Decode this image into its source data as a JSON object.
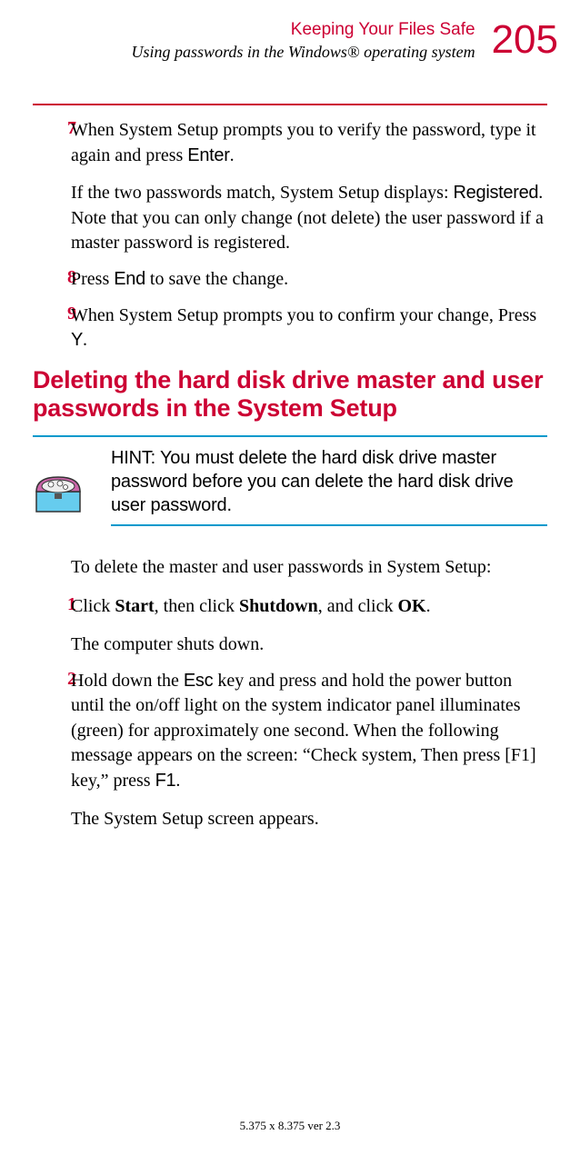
{
  "header": {
    "title": "Keeping Your Files Safe",
    "subtitle": "Using passwords in the Windows® operating system",
    "page_number": "205"
  },
  "steps_top": [
    {
      "num": "7",
      "p1_a": "When System Setup prompts you to verify the password, type it again and press ",
      "p1_k": "Enter",
      "p1_b": ".",
      "p2_a": "If the two passwords match, System Setup displays: ",
      "p2_k": "Registered",
      "p2_b": ". Note that you can only change (not delete) the user password if a master password is registered."
    },
    {
      "num": "8",
      "p1_a": "Press ",
      "p1_k": "End",
      "p1_b": " to save the change."
    },
    {
      "num": "9",
      "p1_a": "When System Setup prompts you to confirm your change, Press ",
      "p1_k": "Y",
      "p1_b": "."
    }
  ],
  "section_heading": "Deleting the hard disk drive master and user passwords in the System Setup",
  "hint": "HINT: You must delete the hard disk drive master password before you can delete the hard disk drive user password.",
  "intro": "To delete the master and user passwords in System Setup:",
  "steps_bottom": [
    {
      "num": "1",
      "p1_a": "Click ",
      "p1_s1": "Start",
      "p1_b": ", then click ",
      "p1_s2": "Shutdown",
      "p1_c": ", and click ",
      "p1_s3": "OK",
      "p1_d": ".",
      "p2": "The computer shuts down."
    },
    {
      "num": "2",
      "p1_a": "Hold down the ",
      "p1_k1": "Esc",
      "p1_b": " key and press and hold the power button until the on/off light on the system indicator panel illuminates (green) for approximately one second. When the following message appears on the screen: “Check system, Then press [F1] key,” press ",
      "p1_k2": "F1",
      "p1_c": ".",
      "p2": "The System Setup screen appears."
    }
  ],
  "footer": "5.375 x 8.375 ver 2.3"
}
